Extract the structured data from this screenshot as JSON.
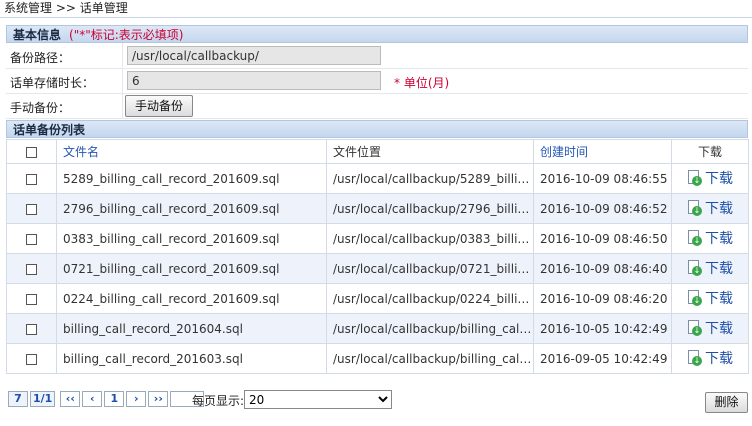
{
  "breadcrumb": "系统管理 >> 话单管理",
  "basic": {
    "title": "基本信息",
    "hint": "(\"*\"标记:表示必填项)",
    "backup_path_label": "备份路径：",
    "backup_path_value": "/usr/local/callbackup/",
    "retention_label": "话单存储时长：",
    "retention_value": "6",
    "retention_unit": "* 单位(月)",
    "manual_label": "手动备份：",
    "manual_button": "手动备份"
  },
  "list": {
    "title": "话单备份列表",
    "columns": {
      "filename": "文件名",
      "location": "文件位置",
      "created": "创建时间",
      "download": "下载"
    },
    "download_label": "下载",
    "rows": [
      {
        "filename": "5289_billing_call_record_201609.sql",
        "location": "/usr/local/callbackup/5289_billing...",
        "created": "2016-10-09 08:46:55"
      },
      {
        "filename": "2796_billing_call_record_201609.sql",
        "location": "/usr/local/callbackup/2796_billing...",
        "created": "2016-10-09 08:46:52"
      },
      {
        "filename": "0383_billing_call_record_201609.sql",
        "location": "/usr/local/callbackup/0383_billing...",
        "created": "2016-10-09 08:46:50"
      },
      {
        "filename": "0721_billing_call_record_201609.sql",
        "location": "/usr/local/callbackup/0721_billing...",
        "created": "2016-10-09 08:46:40"
      },
      {
        "filename": "0224_billing_call_record_201609.sql",
        "location": "/usr/local/callbackup/0224_billing...",
        "created": "2016-10-09 08:46:20"
      },
      {
        "filename": "billing_call_record_201604.sql",
        "location": "/usr/local/callbackup/billing_call_r...",
        "created": "2016-10-05 10:42:49"
      },
      {
        "filename": "billing_call_record_201603.sql",
        "location": "/usr/local/callbackup/billing_call_r...",
        "created": "2016-09-05 10:42:49"
      }
    ]
  },
  "pager": {
    "total": "7",
    "pages": "1/1",
    "first": "‹‹",
    "prev": "‹",
    "current": "1",
    "next": "›",
    "last": "››",
    "per_page_label": "每页显示:",
    "per_page_value": "20"
  },
  "delete_button": "删除"
}
